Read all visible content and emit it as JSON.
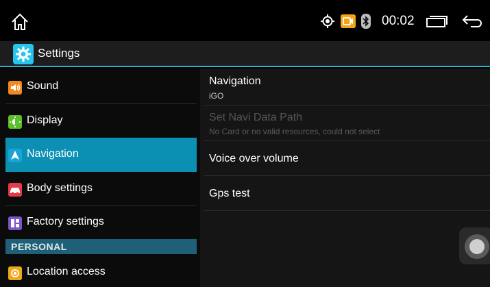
{
  "status_bar": {
    "time": "00:02",
    "icons": [
      "home-icon",
      "gps-icon",
      "camera-icon",
      "bluetooth-icon",
      "recents-icon",
      "back-icon"
    ]
  },
  "app": {
    "title": "Settings",
    "accent_color": "#27b4d4"
  },
  "left_menu": {
    "items": [
      {
        "label": "Sound",
        "icon": "sound-icon",
        "icon_color": "#f08a1e"
      },
      {
        "label": "Display",
        "icon": "display-icon",
        "icon_color": "#5cbf2a"
      },
      {
        "label": "Navigation",
        "icon": "navigation-icon",
        "icon_color": "#1aa3d6",
        "selected": true
      },
      {
        "label": "Body settings",
        "icon": "body-settings-icon",
        "icon_color": "#e8394a"
      },
      {
        "label": "Factory settings",
        "icon": "factory-settings-icon",
        "icon_color": "#7b55c9"
      }
    ],
    "section_header": "PERSONAL",
    "personal_items": [
      {
        "label": "Location access",
        "icon": "location-access-icon",
        "icon_color": "#f0a818"
      }
    ]
  },
  "navigation_prefs": [
    {
      "title": "Navigation",
      "summary": "iGO",
      "enabled": true
    },
    {
      "title": "Set Navi Data Path",
      "summary": "No Card or no valid resources, could not select",
      "enabled": false
    },
    {
      "title": "Voice over volume",
      "summary": "",
      "enabled": true
    },
    {
      "title": "Gps test",
      "summary": "",
      "enabled": true
    }
  ]
}
